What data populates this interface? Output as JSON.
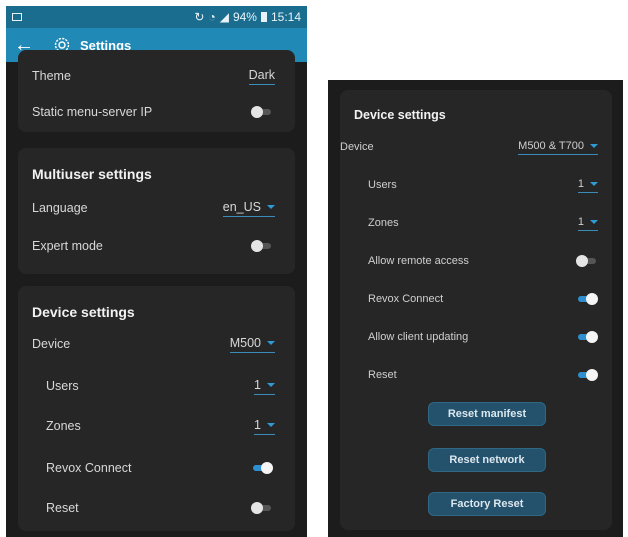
{
  "status_bar": {
    "time": "15:14",
    "battery": "94%"
  },
  "app_bar": {
    "back_icon": "arrow-left-icon",
    "gear_icon": "gear-icon",
    "title": "Settings"
  },
  "general": {
    "theme_label": "Theme",
    "theme_value": "Dark",
    "static_ip_label": "Static menu-server IP",
    "static_ip_on": false
  },
  "multiuser": {
    "title": "Multiuser settings",
    "language_label": "Language",
    "language_value": "en_US",
    "expert_label": "Expert mode",
    "expert_on": false
  },
  "device_left": {
    "title": "Device settings",
    "device_label": "Device",
    "device_value": "M500",
    "users_label": "Users",
    "users_value": "1",
    "zones_label": "Zones",
    "zones_value": "1",
    "revox_label": "Revox Connect",
    "revox_on": true,
    "reset_label": "Reset",
    "reset_on": false
  },
  "device_right": {
    "title": "Device settings",
    "device_label": "Device",
    "device_value": "M500 & T700",
    "users_label": "Users",
    "users_value": "1",
    "zones_label": "Zones",
    "zones_value": "1",
    "remote_label": "Allow remote access",
    "remote_on": false,
    "revox_label": "Revox Connect",
    "revox_on": true,
    "client_label": "Allow client updating",
    "client_on": true,
    "reset_label": "Reset",
    "reset_on": true,
    "buttons": [
      "Reset manifest",
      "Reset network",
      "Factory Reset"
    ]
  },
  "colors": {
    "status_bar": "#1b6d90",
    "app_bar": "#2189b6",
    "card": "#262626",
    "background": "#1c1c1c",
    "accent": "#2e9bd4",
    "button": "#24516c"
  }
}
